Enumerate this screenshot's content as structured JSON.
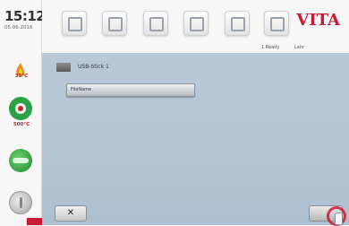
{
  "sidebar": {
    "time": "15:12",
    "date": "05.06.2016",
    "temp_top": "35°C",
    "temp_bottom": "500°C"
  },
  "topbar": {
    "brand": "VITA",
    "tabs": [
      {
        "icon": "program-icon"
      },
      {
        "icon": "person-icon"
      },
      {
        "icon": "settings-icon"
      },
      {
        "icon": "furnace-icon"
      },
      {
        "icon": "camera-icon"
      },
      {
        "icon": "user-icon"
      }
    ]
  },
  "status": {
    "left": "1 Ready",
    "right": "Lahr"
  },
  "main": {
    "usb_label": "USB-Stick 1",
    "file_label": "FileName"
  },
  "buttons": {
    "cancel": "✕"
  },
  "colors": {
    "brand": "#c81b35",
    "panel": "#b9c8d6",
    "accent_green": "#2aa143"
  }
}
